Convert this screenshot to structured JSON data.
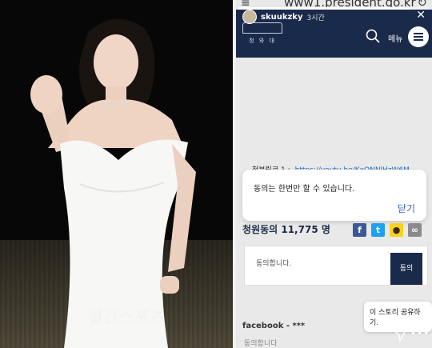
{
  "browser": {
    "url": "www1.president.go.kr",
    "reload_glyph": "↻",
    "menu_glyph": "≡"
  },
  "story": {
    "username": "skuukzky",
    "time": "3시간",
    "close_glyph": "✕",
    "progress": 0.9,
    "share_tooltip": "이 스토리 공유하기.",
    "more_glyph": "•••"
  },
  "site": {
    "emblem_text": "청 와 대",
    "menu_label": "메뉴",
    "link_label": "청부링크 1 :",
    "link_url": "https://youtu.be/KxONNlHzW6M",
    "petition_label": "청원동의",
    "petition_count": "11,775",
    "petition_unit": "명",
    "agree_placeholder": "동의합니다.",
    "agree_button": "동의",
    "comment_author": "facebook - ***",
    "comment_text": "동의합니다"
  },
  "dialog": {
    "message": "동의는 한번만 할 수 있습니다.",
    "close_label": "닫기"
  },
  "photo": {
    "watermark": "일간스포츠"
  },
  "colors": {
    "navy": "#1a2a4a",
    "link": "#1e66b3",
    "dialog_button": "#3a63c9",
    "facebook": "#3b5998",
    "twitter": "#1da1f2",
    "kakao": "#f7d21e"
  },
  "social": [
    {
      "icon": "facebook-icon",
      "glyph": "f"
    },
    {
      "icon": "twitter-icon",
      "glyph": "t"
    },
    {
      "icon": "kakao-icon",
      "glyph": "●"
    },
    {
      "icon": "link-icon",
      "glyph": "∞"
    }
  ]
}
